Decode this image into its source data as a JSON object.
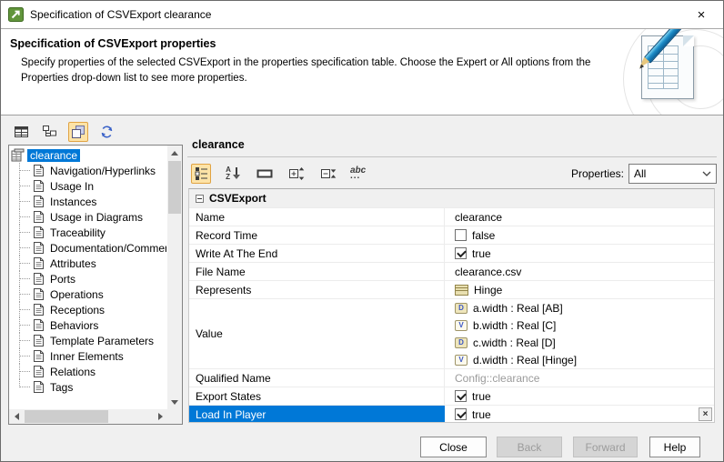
{
  "window": {
    "title": "Specification of CSVExport clearance"
  },
  "icons": {
    "close": "×",
    "remove": "×",
    "sort_top": "A",
    "sort_bottom": "Z",
    "abc_text": "abc",
    "abc_dots": "..."
  },
  "colors": {
    "selection_blue": "#0078d7",
    "toolbar_highlight": "#fde3a7",
    "titlebar_icon_green": "#61953b",
    "muted_text": "#9b9b9b"
  },
  "header": {
    "title": "Specification of CSVExport properties",
    "description_line1": "Specify properties of the selected CSVExport in the properties specification table. Choose the Expert or All options from the",
    "description_line2": "Properties drop-down list to see more properties."
  },
  "left_panel": {
    "tree": {
      "root": {
        "label": "clearance",
        "selected": true
      },
      "items": [
        "Navigation/Hyperlinks",
        "Usage In",
        "Instances",
        "Usage in Diagrams",
        "Traceability",
        "Documentation/Commer",
        "Attributes",
        "Ports",
        "Operations",
        "Receptions",
        "Behaviors",
        "Template Parameters",
        "Inner Elements",
        "Relations",
        "Tags"
      ]
    }
  },
  "right_panel": {
    "title": "clearance",
    "properties_label": "Properties:",
    "properties_value": "All",
    "table": {
      "group_label": "CSVExport",
      "rows": [
        {
          "label": "Name",
          "value": "clearance"
        },
        {
          "label": "Record Time",
          "value": "false",
          "checked": false
        },
        {
          "label": "Write At The End",
          "value": "true",
          "checked": true
        },
        {
          "label": "File Name",
          "value": "clearance.csv"
        },
        {
          "label": "Represents",
          "value": "Hinge"
        },
        {
          "label": "Value",
          "items": [
            {
              "badge": "D",
              "text": "a.width : Real [AB]"
            },
            {
              "badge": "V",
              "text": "b.width : Real [C]"
            },
            {
              "badge": "D",
              "text": "c.width : Real [D]"
            },
            {
              "badge": "V",
              "text": "d.width : Real [Hinge]"
            }
          ]
        },
        {
          "label": "Qualified Name",
          "value": "Config::clearance",
          "muted": true
        },
        {
          "label": "Export States",
          "value": "true",
          "checked": true
        },
        {
          "label": "Load In Player",
          "value": "true",
          "checked": true,
          "selected": true
        }
      ]
    }
  },
  "footer": {
    "close": "Close",
    "back": "Back",
    "forward": "Forward",
    "help": "Help"
  }
}
